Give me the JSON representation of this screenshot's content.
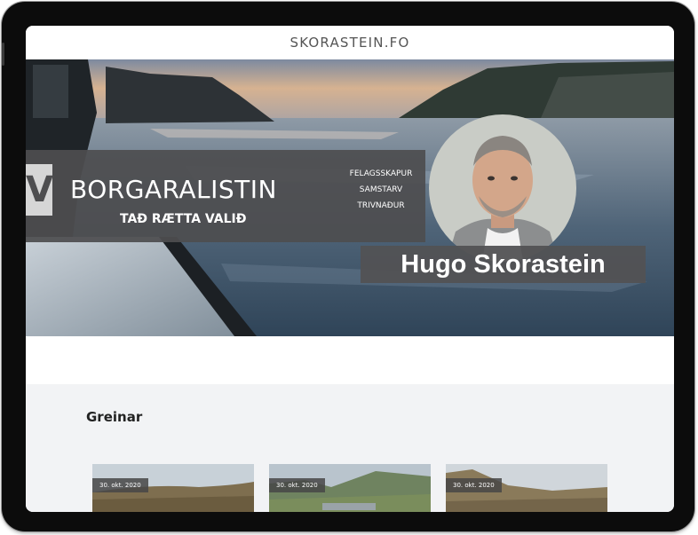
{
  "header": {
    "site_title": "SKORASTEIN.FO"
  },
  "hero": {
    "logo_letter": "V",
    "party_name": "BORGARALISTIN",
    "slogan": "TAÐ RÆTTA VALIÐ",
    "values": [
      "FELAGSSKAPUR",
      "SAMSTARV",
      "TRIVNAÐUR"
    ],
    "candidate_name": "Hugo Skorastein"
  },
  "articles": {
    "section_title": "Greinar",
    "cards": [
      {
        "date": "30. okt. 2020"
      },
      {
        "date": "30. okt. 2020"
      },
      {
        "date": "30. okt. 2020"
      }
    ]
  },
  "colors": {
    "banner": "#4e4e50",
    "section_bg": "#f2f3f5",
    "device_frame": "#0c0c0c"
  }
}
